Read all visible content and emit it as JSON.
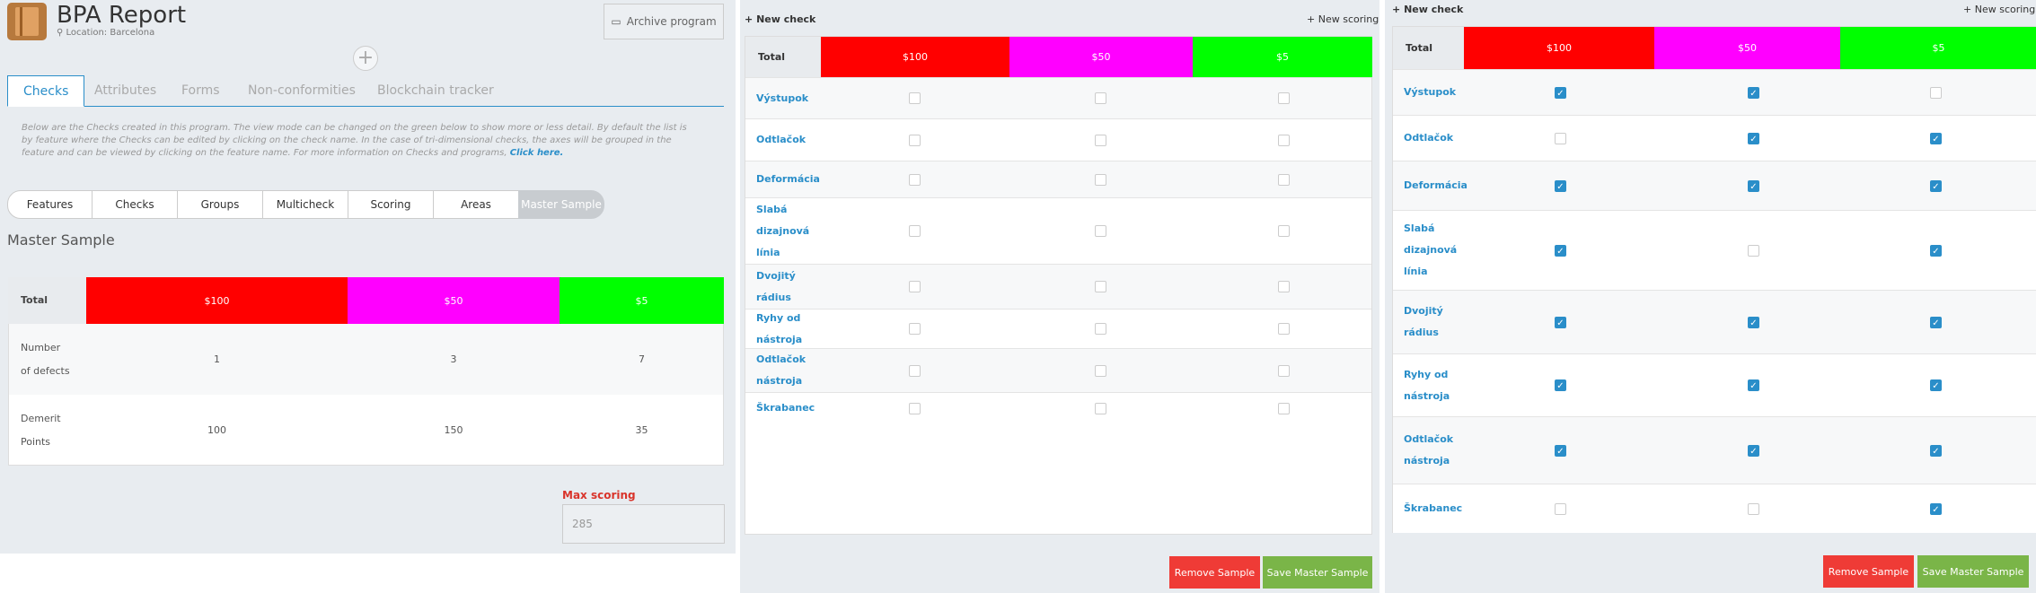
{
  "app": {
    "title": "BPA Report",
    "location": "Location: Barcelona",
    "archive_label": "Archive program"
  },
  "tabs": [
    "Checks",
    "Attributes",
    "Forms",
    "Non-conformities",
    "Blockchain tracker"
  ],
  "description": "Below are the Checks created in this program. The view mode can be changed on the green below to show more or less detail. By default the list is by feature where the Checks can be edited by clicking on the check name. In the case of tri-dimensional checks, the axes will be grouped in the feature and can be viewed by clicking on the feature name. For more information on Checks and programs,",
  "description_link": "Click here.",
  "view_modes": [
    "Features",
    "Checks",
    "Groups",
    "Multicheck",
    "Scoring",
    "Areas",
    "Master Sample"
  ],
  "section_title": "Master Sample",
  "scoring": {
    "columns": [
      {
        "label": "$100",
        "color": "#ff0000"
      },
      {
        "label": "$50",
        "color": "#ff00ff"
      },
      {
        "label": "$5",
        "color": "#00ff00"
      }
    ],
    "total_label": "Total",
    "rows": [
      {
        "label": "Number of defects",
        "values": [
          "1",
          "3",
          "7"
        ]
      },
      {
        "label": "Demerit Points",
        "values": [
          "100",
          "150",
          "35"
        ]
      }
    ]
  },
  "max_scoring": {
    "label": "Max scoring",
    "value": "285"
  },
  "check_panel": {
    "new_check": "New check",
    "new_scoring": "New scoring",
    "total_label": "Total",
    "columns": [
      "$100",
      "$50",
      "$5"
    ],
    "rows": [
      "Výstupok",
      "Odtlačok",
      "Deformácia",
      "Slabá dizajnová línia",
      "Dvojitý rádius",
      "Ryhy od nástroja",
      "Odtlačok nástroja",
      "Škrabanec"
    ],
    "remove_label": "Remove Sample",
    "save_label": "Save Master Sample"
  },
  "panel2_checks": [
    [
      false,
      false,
      false
    ],
    [
      false,
      false,
      false
    ],
    [
      false,
      false,
      false
    ],
    [
      false,
      false,
      false
    ],
    [
      false,
      false,
      false
    ],
    [
      false,
      false,
      false
    ],
    [
      false,
      false,
      false
    ],
    [
      false,
      false,
      false
    ]
  ],
  "panel3_checks": [
    [
      true,
      true,
      false
    ],
    [
      false,
      true,
      true
    ],
    [
      true,
      true,
      true
    ],
    [
      true,
      false,
      true
    ],
    [
      true,
      true,
      true
    ],
    [
      true,
      true,
      true
    ],
    [
      true,
      true,
      true
    ],
    [
      false,
      false,
      true
    ]
  ]
}
